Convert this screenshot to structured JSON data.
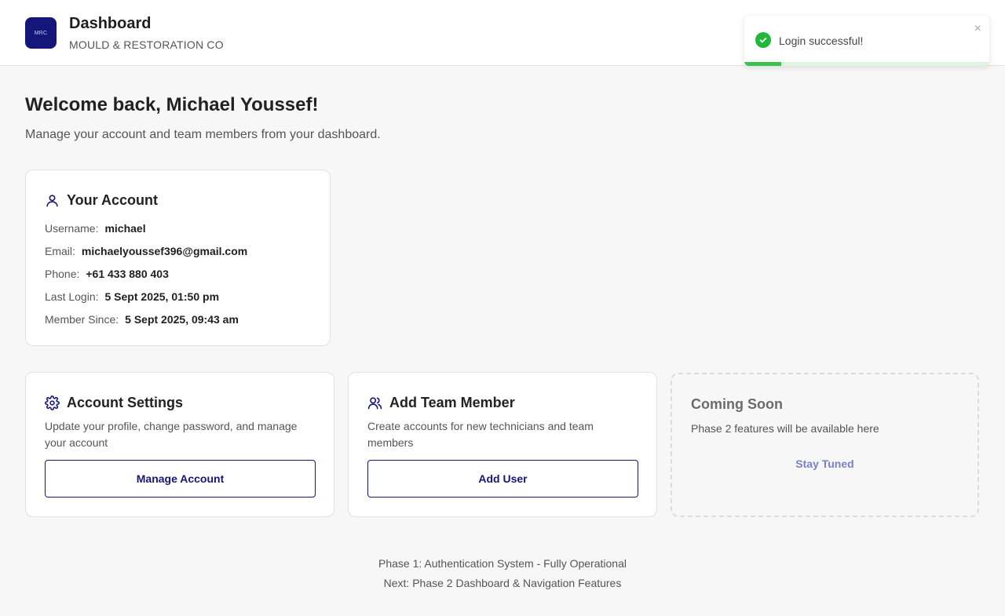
{
  "header": {
    "logo_text": "MRC",
    "title": "Dashboard",
    "subtitle": "MOULD & RESTORATION CO"
  },
  "welcome": {
    "title": "Welcome back, Michael Youssef!",
    "subtitle": "Manage your account and team members from your dashboard."
  },
  "account": {
    "title": "Your Account",
    "fields": [
      {
        "label": "Username:",
        "value": "michael"
      },
      {
        "label": "Email:",
        "value": "michaelyoussef396@gmail.com"
      },
      {
        "label": "Phone:",
        "value": "+61 433 880 403"
      },
      {
        "label": "Last Login:",
        "value": "5 Sept 2025, 01:50 pm"
      },
      {
        "label": "Member Since:",
        "value": "5 Sept 2025, 09:43 am"
      }
    ]
  },
  "settings_card": {
    "title": "Account Settings",
    "description": "Update your profile, change password, and manage your account",
    "button_label": "Manage Account"
  },
  "team_card": {
    "title": "Add Team Member",
    "description": "Create accounts for new technicians and team members",
    "button_label": "Add User"
  },
  "soon_card": {
    "title": "Coming Soon",
    "description": "Phase 2 features will be available here",
    "button_label": "Stay Tuned"
  },
  "footer": {
    "line1": "Phase 1: Authentication System - Fully Operational",
    "line2": "Next: Phase 2 Dashboard & Navigation Features"
  },
  "toast": {
    "message": "Login successful!",
    "close_glyph": "×",
    "progress": 0.15
  },
  "colors": {
    "brand": "#14167a",
    "success": "#1fb83a",
    "background": "#f7f7f7"
  }
}
